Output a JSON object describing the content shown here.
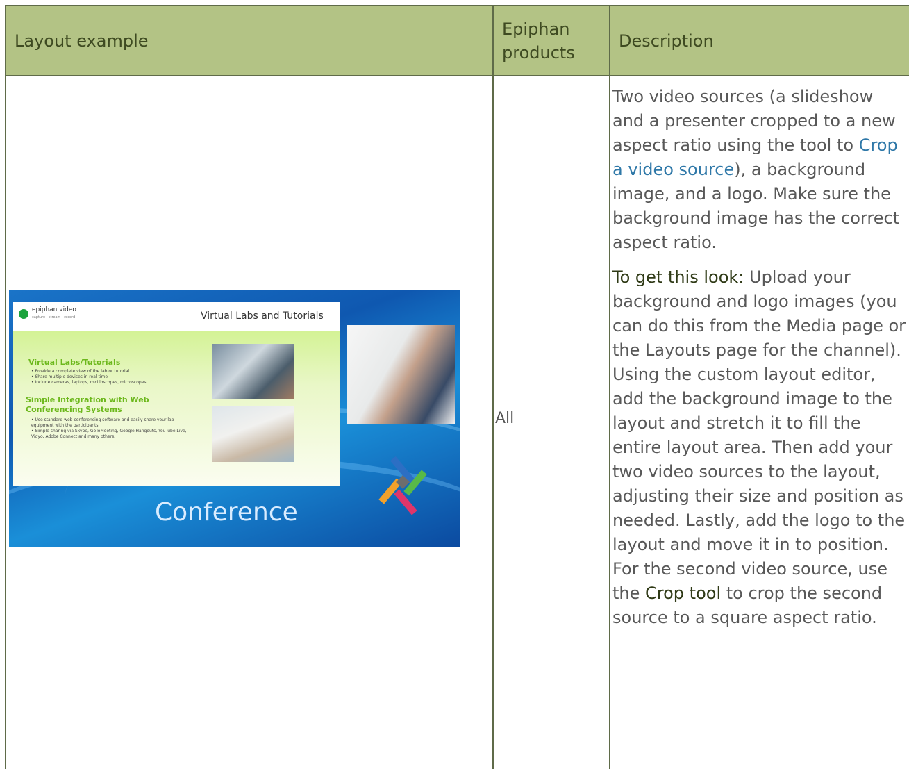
{
  "table": {
    "headers": [
      "Layout example",
      "Epiphan products",
      "Description"
    ],
    "header_bg": "#b3c385",
    "border_color": "#5f6b49",
    "rows": [
      {
        "products": "All",
        "description": {
          "p1_before_link": "Two video sources (a slideshow and a presenter cropped to a new aspect ratio using the tool to ",
          "p1_link": "Crop a video source",
          "p1_after_link": "), a background image, and a logo. Make sure the background image has the correct aspect ratio.",
          "p2_label": "To get this look:",
          "p2_text_a": " Upload your background and logo images (you can do this from the Media page or the Layouts page for the channel). Using the custom layout editor, add the background image to the layout and stretch it to fill the entire layout area. Then add your two video sources to the layout, adjusting their size and position as needed. Lastly, add the logo to the layout and move it in to position. For the second video source, use the ",
          "p2_crop": "Crop tool",
          "p2_text_b": " to crop the second source to a square aspect ratio."
        }
      }
    ]
  },
  "example_image": {
    "brand": "epiphan video",
    "brand_sub": "capture · stream · record",
    "slide_title": "Virtual Labs and Tutorials",
    "heading1": "Virtual Labs/Tutorials",
    "bullets1": [
      "• Provide a complete view of the lab or tutorial",
      "• Share multiple devices in real time",
      "• Include cameras, laptops, oscilloscopes, microscopes"
    ],
    "heading2a": "Simple Integration with Web",
    "heading2b": "Conferencing Systems",
    "bullets2": [
      "• Use standard web conferencing software and easily share your lab equipment with the participants",
      "• Simple sharing via Skype, GoToMeeting, Google Hangouts, YouTube Live, Vidyo, Adobe Connect and many others."
    ],
    "background_word": "Conference"
  },
  "colors": {
    "link": "#2f78a8",
    "header_text": "#3e4a21",
    "body_text": "#585858"
  }
}
